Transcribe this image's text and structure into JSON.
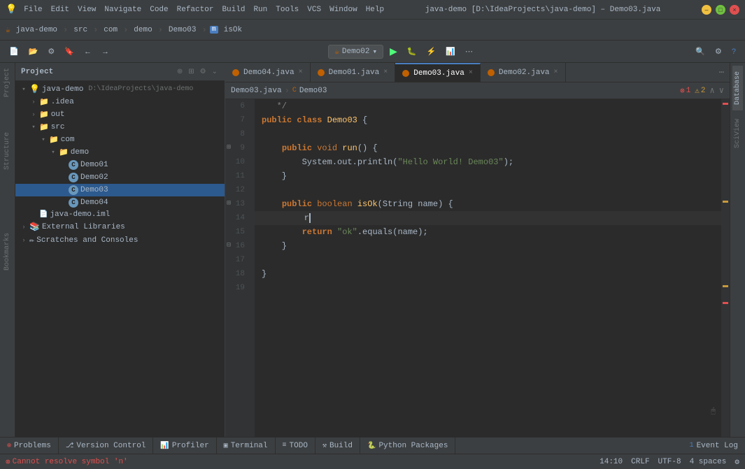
{
  "titlebar": {
    "menus": [
      "java-demo",
      "File",
      "Edit",
      "View",
      "Navigate",
      "Code",
      "Refactor",
      "Build",
      "Run",
      "Tools",
      "VCS",
      "Window",
      "Help"
    ],
    "title": "java-demo [D:\\IdeaProjects\\java-demo] – Demo03.java",
    "window_title": "java-demo [D:\\IdeaProjects\\java-demo] – Demo03.java"
  },
  "navbar": {
    "items": [
      "java-demo",
      "src",
      "com",
      "demo",
      "Demo03",
      "isOk"
    ]
  },
  "toolbar": {
    "run_config": "Demo02",
    "search_icon": "🔍",
    "settings_icon": "⚙"
  },
  "project_panel": {
    "title": "Project",
    "root": {
      "name": "java-demo",
      "path": "D:\\IdeaProjects\\java-demo",
      "children": [
        {
          "name": ".idea",
          "type": "folder",
          "expanded": false
        },
        {
          "name": "out",
          "type": "folder",
          "expanded": false
        },
        {
          "name": "src",
          "type": "folder",
          "expanded": true,
          "children": [
            {
              "name": "com",
              "type": "folder",
              "expanded": true,
              "children": [
                {
                  "name": "demo",
                  "type": "folder",
                  "expanded": true,
                  "children": [
                    {
                      "name": "Demo01",
                      "type": "java"
                    },
                    {
                      "name": "Demo02",
                      "type": "java"
                    },
                    {
                      "name": "Demo03",
                      "type": "java",
                      "selected": true
                    },
                    {
                      "name": "Demo04",
                      "type": "java"
                    }
                  ]
                }
              ]
            }
          ]
        },
        {
          "name": "java-demo.iml",
          "type": "xml"
        },
        {
          "name": "External Libraries",
          "type": "lib"
        },
        {
          "name": "Scratches and Consoles",
          "type": "scratch"
        }
      ]
    }
  },
  "tabs": [
    {
      "name": "Demo04.java",
      "active": false,
      "color": "#c06000"
    },
    {
      "name": "Demo01.java",
      "active": false,
      "color": "#c06000"
    },
    {
      "name": "Demo03.java",
      "active": true,
      "color": "#c06000"
    },
    {
      "name": "Demo02.java",
      "active": false,
      "color": "#c06000"
    }
  ],
  "editor": {
    "filename": "Demo03.java",
    "errors": "1",
    "warnings": "2",
    "lines": [
      {
        "num": 6,
        "content": "   */",
        "tokens": [
          {
            "text": "   */",
            "class": "comment"
          }
        ]
      },
      {
        "num": 7,
        "content": "public class Demo03 {",
        "tokens": [
          {
            "text": "public ",
            "class": "kw"
          },
          {
            "text": "class ",
            "class": "kw"
          },
          {
            "text": "Demo03",
            "class": "cls"
          },
          {
            "text": " {",
            "class": "punct"
          }
        ]
      },
      {
        "num": 8,
        "content": "",
        "tokens": []
      },
      {
        "num": 9,
        "content": "    public void run() {",
        "tokens": [
          {
            "text": "    "
          },
          {
            "text": "public ",
            "class": "kw"
          },
          {
            "text": "void ",
            "class": "kw2"
          },
          {
            "text": "run",
            "class": "fn"
          },
          {
            "text": "() {",
            "class": "punct"
          }
        ]
      },
      {
        "num": 10,
        "content": "        System.out.println(\"Hello World! Demo03\");",
        "tokens": [
          {
            "text": "        System.",
            "class": "type"
          },
          {
            "text": "out",
            "class": "param"
          },
          {
            "text": ".println(",
            "class": "punct"
          },
          {
            "text": "\"Hello World! Demo03\"",
            "class": "str"
          },
          {
            "text": ");",
            "class": "punct"
          }
        ]
      },
      {
        "num": 11,
        "content": "    }",
        "tokens": [
          {
            "text": "    }"
          }
        ]
      },
      {
        "num": 12,
        "content": "",
        "tokens": []
      },
      {
        "num": 13,
        "content": "    public boolean isOk(String name) {",
        "tokens": [
          {
            "text": "    "
          },
          {
            "text": "public ",
            "class": "kw"
          },
          {
            "text": "boolean ",
            "class": "kw2"
          },
          {
            "text": "isOk",
            "class": "fn"
          },
          {
            "text": "(",
            "class": "punct"
          },
          {
            "text": "String ",
            "class": "type"
          },
          {
            "text": "name",
            "class": "param"
          },
          {
            "text": ") {",
            "class": "punct"
          }
        ]
      },
      {
        "num": 14,
        "content": "        r",
        "tokens": [
          {
            "text": "        r",
            "class": ""
          }
        ],
        "active": true,
        "error": true
      },
      {
        "num": 15,
        "content": "        return \"ok\".equals(name);",
        "tokens": [
          {
            "text": "        "
          },
          {
            "text": "return ",
            "class": "kw"
          },
          {
            "text": "\"ok\"",
            "class": "str"
          },
          {
            "text": ".equals(",
            "class": "punct"
          },
          {
            "text": "name",
            "class": "param"
          },
          {
            "text": ");",
            "class": "punct"
          }
        ]
      },
      {
        "num": 16,
        "content": "    }",
        "tokens": [
          {
            "text": "    }",
            "class": "punct"
          }
        ]
      },
      {
        "num": 17,
        "content": "",
        "tokens": []
      },
      {
        "num": 18,
        "content": "}",
        "tokens": [
          {
            "text": "}"
          }
        ]
      },
      {
        "num": 19,
        "content": "",
        "tokens": []
      }
    ],
    "gutter_markers": [
      {
        "line": 9,
        "type": "method",
        "char": "▶"
      },
      {
        "line": 13,
        "type": "method",
        "char": "▶"
      },
      {
        "line": 16,
        "type": "end",
        "char": "⊟"
      }
    ]
  },
  "bottom_tabs": [
    {
      "name": "Problems",
      "icon": "⚠",
      "active": false
    },
    {
      "name": "Version Control",
      "icon": "⎇",
      "active": false
    },
    {
      "name": "Profiler",
      "icon": "📊",
      "active": false
    },
    {
      "name": "Terminal",
      "icon": "▣",
      "active": false
    },
    {
      "name": "TODO",
      "icon": "≡",
      "active": false
    },
    {
      "name": "Build",
      "icon": "⚒",
      "active": false
    },
    {
      "name": "Python Packages",
      "icon": "🐍",
      "active": false
    }
  ],
  "event_log": {
    "label": "Event Log",
    "count": "1"
  },
  "status_bar": {
    "error_text": "Cannot resolve symbol 'n'",
    "position": "14:10",
    "line_ending": "CRLF",
    "encoding": "UTF-8",
    "indent": "4 spaces"
  },
  "right_sidebar": {
    "tabs": [
      "Database",
      "SciView"
    ]
  }
}
